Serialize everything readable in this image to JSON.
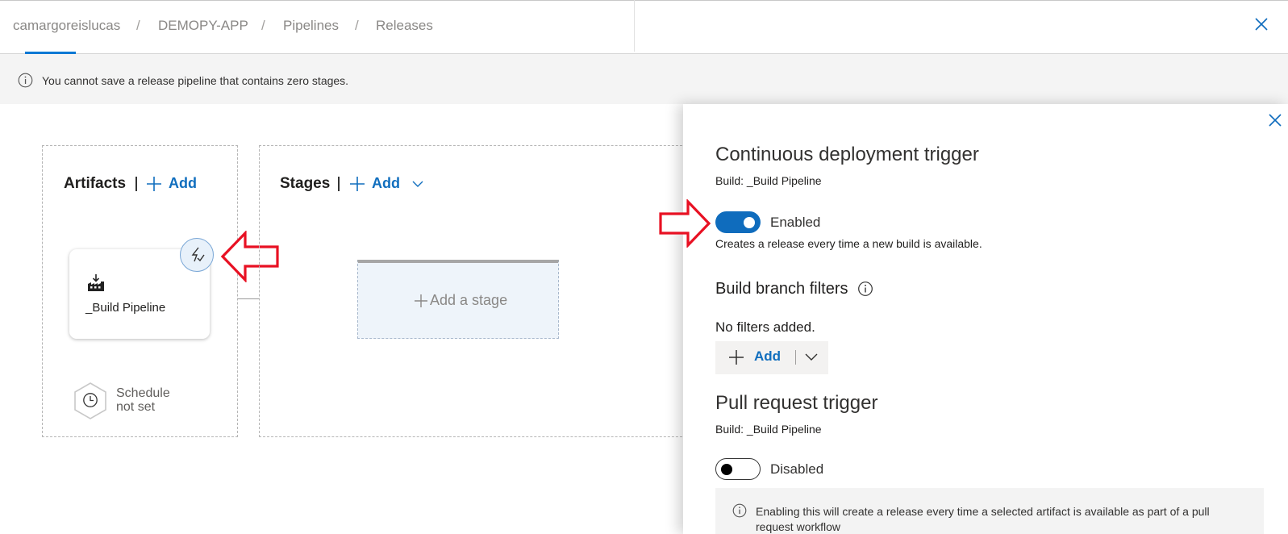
{
  "breadcrumb": [
    "camargoreislucas",
    "DEMOPY-APP",
    "Pipelines",
    "Releases"
  ],
  "breadcrumb_separator": "/",
  "banner": {
    "icon": "info-icon",
    "text": "You cannot save a release pipeline that contains zero stages."
  },
  "artifacts": {
    "title": "Artifacts",
    "add_label": "Add"
  },
  "artifact_card": {
    "icon": "build-artifact-icon",
    "name": "_Build Pipeline",
    "trigger_icon": "lightning-trigger-icon"
  },
  "schedule": {
    "icon": "clock-icon",
    "line1": "Schedule",
    "line2": "not set"
  },
  "stages": {
    "title": "Stages",
    "add_label": "Add",
    "placeholder_label": "Add a stage"
  },
  "panel": {
    "title": "Continuous deployment trigger",
    "build_line": "Build: _Build Pipeline",
    "cd_toggle": {
      "state": true,
      "label": "Enabled"
    },
    "cd_description": "Creates a release every time a new build is available.",
    "branch_filters": {
      "title": "Build branch filters",
      "empty_text": "No filters added.",
      "add_label": "Add"
    },
    "pr": {
      "title": "Pull request trigger",
      "build_line": "Build: _Build Pipeline",
      "toggle": {
        "state": false,
        "label": "Disabled"
      },
      "note_line1": "Enabling this will create a release every time a selected artifact is available as part of a pull",
      "note_line2": "request workflow"
    }
  },
  "colors": {
    "accent": "#0f6cbd",
    "link": "#106ebe",
    "annotation_arrow": "#e81123"
  }
}
